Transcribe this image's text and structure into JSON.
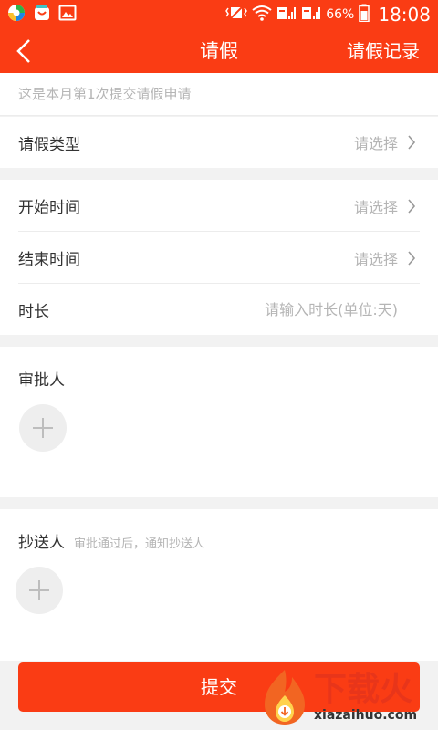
{
  "status_bar": {
    "battery": "66%",
    "time": "18:08"
  },
  "nav": {
    "title": "请假",
    "right_action": "请假记录"
  },
  "notice": "这是本月第1次提交请假申请",
  "leave_type": {
    "label": "请假类型",
    "value": "请选择"
  },
  "time_card": {
    "start_label": "开始时间",
    "start_value": "请选择",
    "end_label": "结束时间",
    "end_value": "请选择",
    "duration_label": "时长",
    "duration_placeholder": "请输入时长(单位:天)"
  },
  "approver": {
    "label": "审批人"
  },
  "cc": {
    "label": "抄送人",
    "hint": "审批通过后，通知抄送人"
  },
  "submit_label": "提交",
  "watermark": {
    "cn": "下载火",
    "en": "xiazaihuo.com"
  },
  "colors": {
    "brand": "#fa3c14",
    "placeholder": "#b5b5b5"
  }
}
